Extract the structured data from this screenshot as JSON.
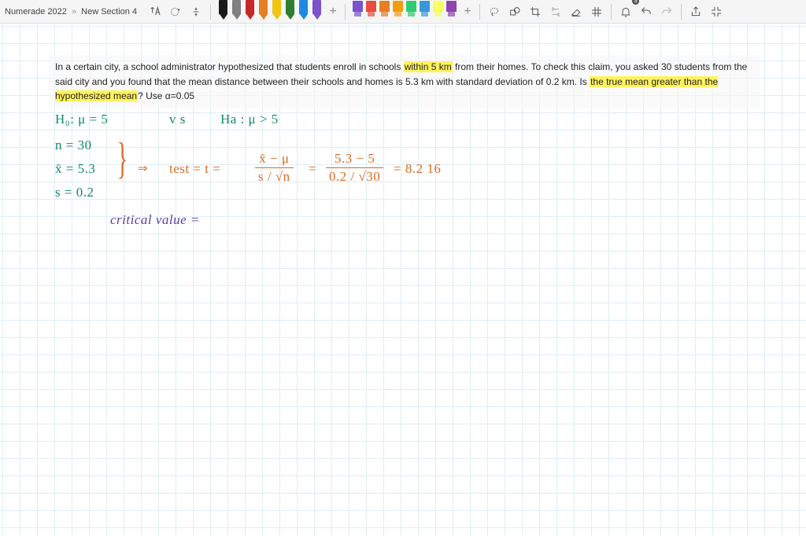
{
  "breadcrumb": {
    "app": "Numerade 2022",
    "section": "New Section 4"
  },
  "toolbar": {
    "pen_colors": [
      "#1a1a1a",
      "#808080",
      "#c62828",
      "#e67e22",
      "#f1c40f",
      "#2e7d32",
      "#1e88e5",
      "#7a52cc"
    ],
    "selected_pen_index": 7,
    "highlighter_colors": [
      "#7a52cc",
      "#e74c3c",
      "#e67e22",
      "#f39c12",
      "#2ecc71",
      "#3498db",
      "#f6ff5c",
      "#8e44ad"
    ],
    "notification_badge": "3"
  },
  "problem": {
    "pre1": "In a certain city, a school administrator hypothesized that students enroll in schools ",
    "hl1": "within 5 km",
    "mid1": " from their homes. To check this claim, you asked 30 students from the said city and you found that the mean distance between their schools and homes is 5.3 km with standard deviation of 0.2 km. Is ",
    "hl2": "the true mean greater than the hypothesized mean",
    "post1": "? Use α=0.05"
  },
  "work": {
    "h0": "H₀:   μ =  5",
    "vs": "v s",
    "ha": "Ha :     μ > 5",
    "n": "n = 30",
    "xbar_label": "x̄ = 5.3",
    "s": "s = 0.2",
    "arrow": "⇒",
    "test_label": "test = t =",
    "num1": "x̄ − μ",
    "den1": "s / √n",
    "eq1": "=",
    "num2": "5.3 − 5",
    "den2": "0.2 / √30",
    "eq2": "=  8.2 16",
    "critical": "critical value   ="
  }
}
